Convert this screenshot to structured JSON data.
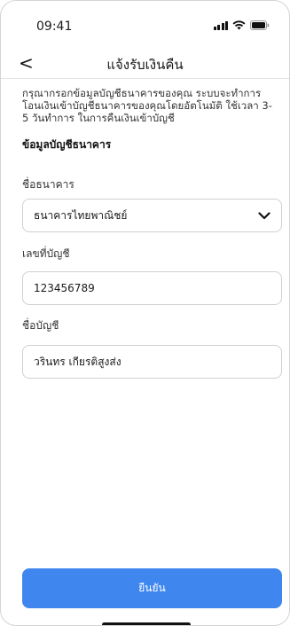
{
  "status_bar": {
    "time": "09:41",
    "signal_icon": "cellular-signal-icon",
    "wifi_icon": "wifi-icon",
    "battery_icon": "battery-icon"
  },
  "header": {
    "back_icon": "chevron-left-icon",
    "back_glyph": "<",
    "title": "แจ้งรับเงินคืน"
  },
  "main": {
    "description": "กรุณากรอกข้อมูลบัญชีธนาคารของคุณ ระบบจะทำการโอนเงินเข้าบัญชีธนาคารของคุณโดยอัตโนมัติ ใช้เวลา 3-5 วันทำการ ในการคืนเงินเข้าบัญชี",
    "section_title": "ข้อมูลบัญชีธนาคาร",
    "bank": {
      "label": "ชื่อธนาคาร",
      "selected_value": "ธนาคารไทยพาณิชย์",
      "chevron_icon": "chevron-down-icon"
    },
    "account_number": {
      "label": "เลขที่บัญชี",
      "value": "123456789"
    },
    "account_name": {
      "label": "ชื่อบัญชี",
      "value": "วรินทร เกียรติสูงส่ง"
    }
  },
  "footer": {
    "confirm_label": "ยืนยัน"
  },
  "colors": {
    "accent": "#3f86ef",
    "border": "#d0d0d0"
  }
}
